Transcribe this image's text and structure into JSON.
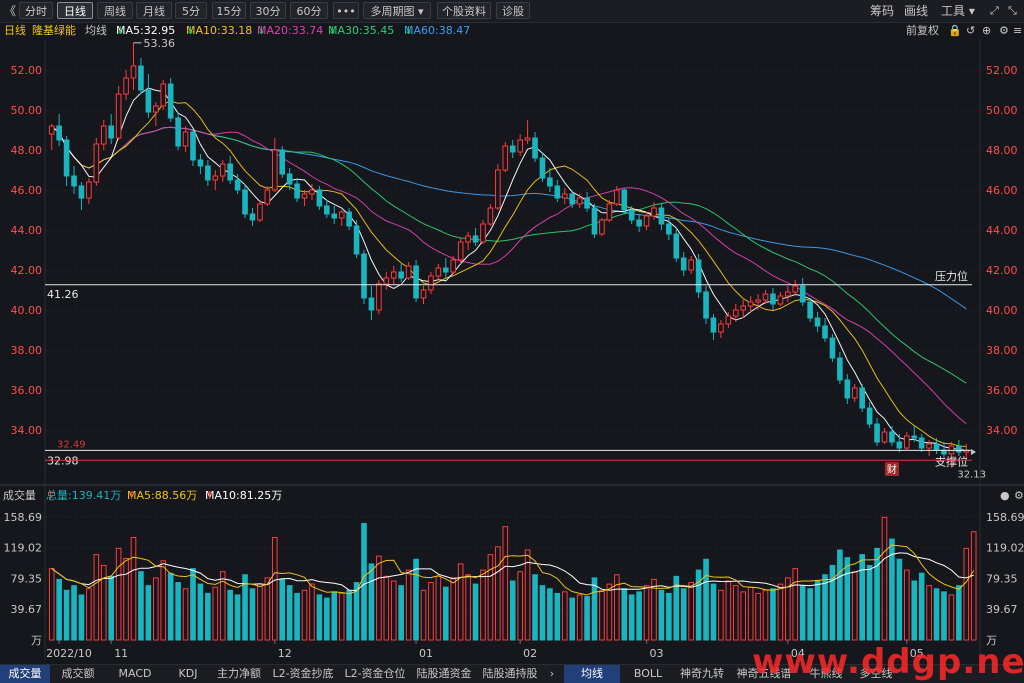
{
  "toolbar": {
    "back": "《",
    "periods": [
      "分时",
      "日线",
      "周线",
      "月线",
      "5分",
      "15分",
      "30分",
      "60分",
      "•••"
    ],
    "active": "日线",
    "multi": "多周期图",
    "info": "个股资料",
    "diag": "诊股",
    "right": [
      "筹码",
      "画线",
      "工具"
    ],
    "icons": [
      "collapse-icon",
      "expand-icon"
    ]
  },
  "legend": {
    "period": "日线",
    "stock": "隆基绿能",
    "indicator": "均线",
    "ma": [
      {
        "label": "MA5:32.95",
        "arrow": "↓",
        "color": "#ffffff",
        "arrowColor": "#22c55e"
      },
      {
        "label": "MA10:33.18",
        "arrow": "↓",
        "color": "#f0c419",
        "arrowColor": "#22c55e"
      },
      {
        "label": "MA20:33.74",
        "arrow": "↓",
        "color": "#e040b0",
        "arrowColor": "#22c55e"
      },
      {
        "label": "MA30:35.45",
        "arrow": "↓",
        "color": "#2ecc71",
        "arrowColor": "#22c55e"
      },
      {
        "label": "MA60:38.47",
        "arrow": "↓",
        "color": "#3b9ef5",
        "arrowColor": "#22c55e"
      }
    ],
    "adjust": "前复权"
  },
  "vol_legend": {
    "title": "成交量",
    "total": "总量:139.41万",
    "ma5": "MA5:88.56万",
    "ma10": "MA10:81.25万",
    "arrow": "↑"
  },
  "bottom_tabs": [
    "成交量",
    "成交额",
    "MACD",
    "KDJ",
    "主力净额",
    "L2-资金抄底",
    "L2-资金仓位",
    "陆股通资金",
    "陆股通持股"
  ],
  "bottom_tabs2": [
    "均线",
    "BOLL",
    "神奇九转",
    "神奇五线谱",
    "牛熊线",
    "多空线"
  ],
  "bottom_arrow": "›",
  "watermark": "www.ddgp.net",
  "colors": {
    "up": "#ff3b3b",
    "down": "#1ab5bf",
    "bg": "#15171c",
    "ma5": "#ffffff",
    "ma10": "#f0c419",
    "ma20": "#e040b0",
    "ma30": "#2ecc71",
    "ma60": "#3b9ef5",
    "accent": "#21407a"
  },
  "chart_data": [
    {
      "type": "candlestick",
      "title": "隆基绿能 日线",
      "ylim": [
        32.0,
        53.5
      ],
      "yticks": [
        "52.00",
        "50.00",
        "48.00",
        "46.00",
        "44.00",
        "42.00",
        "40.00",
        "38.00",
        "36.00",
        "34.00"
      ],
      "ytick_values": [
        52,
        50,
        48,
        46,
        44,
        42,
        40,
        38,
        36,
        34
      ],
      "xticks": [
        {
          "label": "2022/10",
          "index": 1
        },
        {
          "label": "11",
          "index": 8
        },
        {
          "label": "12",
          "index": 30
        },
        {
          "label": "01",
          "index": 49
        },
        {
          "label": "02",
          "index": 63
        },
        {
          "label": "03",
          "index": 80
        },
        {
          "label": "04",
          "index": 99
        },
        {
          "label": "05",
          "index": 115
        }
      ],
      "annotations": {
        "high": {
          "label": "53.36",
          "value": 53.36,
          "index": 11
        },
        "low": {
          "label": "32.13",
          "value": 32.13,
          "index": 124
        },
        "resistance": {
          "label": "压力位",
          "value": 41.26,
          "value_label": "41.26"
        },
        "support": {
          "label": "支撑位",
          "value": 32.98,
          "value_label": "32.98"
        },
        "red_line": {
          "value": 32.49,
          "value_label": "32.49"
        },
        "event": {
          "label": "财",
          "index": 113
        }
      },
      "ohlc": [
        [
          48.8,
          49.3,
          48.0,
          49.2
        ],
        [
          49.2,
          49.8,
          48.2,
          48.5
        ],
        [
          48.5,
          48.7,
          46.2,
          46.7
        ],
        [
          46.7,
          47.2,
          45.8,
          46.2
        ],
        [
          46.2,
          46.4,
          45.0,
          45.6
        ],
        [
          45.6,
          46.6,
          45.3,
          46.4
        ],
        [
          46.4,
          48.6,
          46.2,
          48.3
        ],
        [
          48.3,
          49.5,
          48.0,
          49.2
        ],
        [
          49.2,
          49.8,
          48.3,
          48.6
        ],
        [
          48.6,
          51.2,
          48.5,
          50.8
        ],
        [
          50.8,
          52.0,
          50.5,
          51.6
        ],
        [
          51.6,
          53.36,
          51.0,
          52.2
        ],
        [
          52.2,
          52.6,
          50.8,
          51.0
        ],
        [
          51.0,
          51.8,
          49.6,
          49.9
        ],
        [
          49.9,
          50.4,
          49.2,
          50.2
        ],
        [
          50.2,
          51.5,
          50.0,
          51.3
        ],
        [
          51.3,
          51.6,
          49.4,
          49.6
        ],
        [
          49.6,
          49.9,
          48.0,
          48.2
        ],
        [
          48.2,
          49.2,
          47.9,
          48.9
        ],
        [
          48.9,
          49.0,
          47.2,
          47.5
        ],
        [
          47.5,
          47.8,
          46.8,
          47.2
        ],
        [
          47.2,
          47.5,
          46.2,
          46.5
        ],
        [
          46.5,
          47.0,
          46.0,
          46.7
        ],
        [
          46.7,
          47.5,
          46.4,
          47.3
        ],
        [
          47.3,
          47.7,
          46.3,
          46.5
        ],
        [
          46.5,
          46.8,
          45.8,
          46.0
        ],
        [
          46.0,
          46.3,
          44.6,
          44.8
        ],
        [
          44.8,
          45.1,
          44.2,
          44.5
        ],
        [
          44.5,
          45.5,
          44.4,
          45.3
        ],
        [
          45.3,
          46.2,
          45.2,
          46.0
        ],
        [
          46.0,
          48.6,
          45.9,
          48.0
        ],
        [
          48.0,
          48.2,
          46.6,
          46.8
        ],
        [
          46.8,
          47.1,
          46.0,
          46.3
        ],
        [
          46.3,
          46.6,
          45.4,
          45.6
        ],
        [
          45.6,
          46.0,
          45.2,
          45.8
        ],
        [
          45.8,
          46.3,
          45.5,
          46.0
        ],
        [
          46.0,
          46.2,
          45.0,
          45.2
        ],
        [
          45.2,
          45.5,
          44.6,
          44.8
        ],
        [
          44.8,
          45.2,
          44.3,
          44.6
        ],
        [
          44.6,
          45.0,
          44.2,
          44.9
        ],
        [
          44.9,
          45.1,
          44.0,
          44.2
        ],
        [
          44.2,
          44.5,
          42.6,
          42.8
        ],
        [
          42.8,
          43.0,
          40.3,
          40.6
        ],
        [
          40.6,
          41.2,
          39.5,
          40.0
        ],
        [
          40.0,
          41.5,
          39.8,
          41.3
        ],
        [
          41.3,
          41.9,
          41.0,
          41.6
        ],
        [
          41.6,
          42.2,
          41.3,
          41.9
        ],
        [
          41.9,
          42.3,
          41.4,
          41.6
        ],
        [
          41.6,
          42.4,
          41.5,
          42.2
        ],
        [
          42.2,
          42.5,
          40.4,
          40.6
        ],
        [
          40.6,
          41.2,
          40.3,
          41.0
        ],
        [
          41.0,
          41.9,
          40.8,
          41.7
        ],
        [
          41.7,
          42.3,
          41.5,
          42.1
        ],
        [
          42.1,
          42.6,
          41.6,
          41.9
        ],
        [
          41.9,
          42.7,
          41.8,
          42.5
        ],
        [
          42.5,
          43.6,
          42.3,
          43.4
        ],
        [
          43.4,
          43.9,
          43.0,
          43.7
        ],
        [
          43.7,
          44.1,
          43.2,
          43.4
        ],
        [
          43.4,
          44.5,
          43.3,
          44.3
        ],
        [
          44.3,
          45.3,
          44.2,
          45.1
        ],
        [
          45.1,
          47.3,
          45.0,
          47.0
        ],
        [
          47.0,
          48.4,
          46.9,
          48.2
        ],
        [
          48.2,
          48.5,
          47.6,
          47.9
        ],
        [
          47.9,
          48.8,
          47.7,
          48.5
        ],
        [
          48.5,
          49.5,
          48.3,
          48.6
        ],
        [
          48.6,
          48.9,
          47.4,
          47.6
        ],
        [
          47.6,
          47.9,
          46.4,
          46.6
        ],
        [
          46.6,
          47.1,
          45.9,
          46.2
        ],
        [
          46.2,
          46.5,
          45.4,
          45.6
        ],
        [
          45.6,
          46.1,
          45.3,
          45.8
        ],
        [
          45.8,
          46.0,
          45.1,
          45.3
        ],
        [
          45.3,
          45.8,
          45.1,
          45.6
        ],
        [
          45.6,
          45.9,
          44.9,
          45.1
        ],
        [
          45.1,
          45.3,
          43.6,
          43.8
        ],
        [
          43.8,
          44.6,
          43.7,
          44.5
        ],
        [
          44.5,
          45.5,
          44.4,
          45.3
        ],
        [
          45.3,
          46.2,
          45.2,
          46.0
        ],
        [
          46.0,
          46.1,
          44.8,
          45.0
        ],
        [
          45.0,
          45.2,
          44.3,
          44.5
        ],
        [
          44.5,
          44.8,
          43.9,
          44.2
        ],
        [
          44.2,
          44.9,
          44.0,
          44.7
        ],
        [
          44.7,
          45.4,
          44.5,
          45.1
        ],
        [
          45.1,
          45.3,
          44.0,
          44.3
        ],
        [
          44.3,
          44.6,
          43.5,
          43.8
        ],
        [
          43.8,
          44.1,
          42.4,
          42.6
        ],
        [
          42.6,
          42.9,
          41.7,
          42.0
        ],
        [
          42.0,
          42.7,
          41.8,
          42.5
        ],
        [
          42.5,
          42.8,
          40.6,
          40.9
        ],
        [
          40.9,
          41.2,
          39.3,
          39.6
        ],
        [
          39.6,
          39.8,
          38.5,
          38.9
        ],
        [
          38.9,
          39.5,
          38.6,
          39.3
        ],
        [
          39.3,
          39.9,
          39.1,
          39.7
        ],
        [
          39.7,
          40.3,
          39.4,
          40.0
        ],
        [
          40.0,
          40.5,
          39.6,
          40.2
        ],
        [
          40.2,
          40.7,
          39.9,
          40.4
        ],
        [
          40.4,
          40.8,
          40.0,
          40.5
        ],
        [
          40.5,
          41.0,
          40.3,
          40.8
        ],
        [
          40.8,
          41.1,
          40.0,
          40.3
        ],
        [
          40.3,
          40.9,
          40.2,
          40.7
        ],
        [
          40.7,
          41.2,
          40.4,
          40.9
        ],
        [
          40.9,
          41.5,
          40.7,
          41.2
        ],
        [
          41.2,
          41.6,
          40.2,
          40.4
        ],
        [
          40.4,
          40.6,
          39.4,
          39.6
        ],
        [
          39.6,
          39.9,
          38.9,
          39.2
        ],
        [
          39.2,
          39.6,
          38.4,
          38.6
        ],
        [
          38.6,
          38.8,
          37.4,
          37.6
        ],
        [
          37.6,
          37.9,
          36.3,
          36.5
        ],
        [
          36.5,
          36.8,
          35.3,
          35.6
        ],
        [
          35.6,
          36.3,
          35.4,
          36.1
        ],
        [
          36.1,
          36.3,
          34.9,
          35.1
        ],
        [
          35.1,
          35.4,
          34.1,
          34.3
        ],
        [
          34.3,
          34.6,
          33.2,
          33.4
        ],
        [
          33.4,
          34.1,
          33.3,
          33.9
        ],
        [
          33.9,
          34.2,
          33.2,
          33.4
        ],
        [
          33.4,
          33.8,
          32.9,
          33.1
        ],
        [
          33.1,
          33.9,
          33.0,
          33.7
        ],
        [
          33.7,
          34.2,
          33.4,
          33.6
        ],
        [
          33.6,
          33.8,
          32.9,
          33.1
        ],
        [
          33.1,
          33.5,
          32.7,
          33.3
        ],
        [
          33.3,
          33.6,
          32.8,
          33.0
        ],
        [
          33.0,
          33.4,
          32.6,
          32.8
        ],
        [
          32.8,
          33.4,
          32.13,
          33.2
        ],
        [
          33.2,
          33.5,
          32.7,
          32.9
        ],
        [
          32.9,
          33.3,
          32.5,
          33.0
        ]
      ]
    },
    {
      "type": "bar",
      "title": "成交量",
      "unit": "万",
      "yticks": [
        "158.69",
        "119.02",
        "79.35",
        "39.67"
      ],
      "ytick_values": [
        158.69,
        119.02,
        79.35,
        39.67
      ],
      "ylim": [
        0,
        170
      ],
      "volumes": [
        92,
        78,
        64,
        70,
        58,
        66,
        110,
        96,
        82,
        118,
        105,
        132,
        88,
        70,
        80,
        102,
        86,
        74,
        66,
        92,
        72,
        60,
        68,
        88,
        64,
        58,
        84,
        66,
        72,
        80,
        132,
        78,
        70,
        60,
        64,
        72,
        58,
        54,
        62,
        60,
        64,
        74,
        150,
        98,
        108,
        82,
        76,
        70,
        90,
        104,
        64,
        74,
        82,
        68,
        80,
        98,
        84,
        72,
        90,
        110,
        120,
        146,
        76,
        88,
        116,
        84,
        70,
        66,
        60,
        62,
        54,
        58,
        56,
        80,
        64,
        72,
        84,
        66,
        58,
        62,
        70,
        78,
        64,
        60,
        82,
        66,
        74,
        90,
        104,
        72,
        64,
        76,
        70,
        62,
        68,
        60,
        64,
        66,
        72,
        80,
        92,
        70,
        66,
        76,
        84,
        96,
        116,
        106,
        88,
        110,
        96,
        118,
        158,
        130,
        104,
        90,
        76,
        86,
        70,
        66,
        62,
        58,
        70,
        118,
        139.41
      ]
    }
  ]
}
